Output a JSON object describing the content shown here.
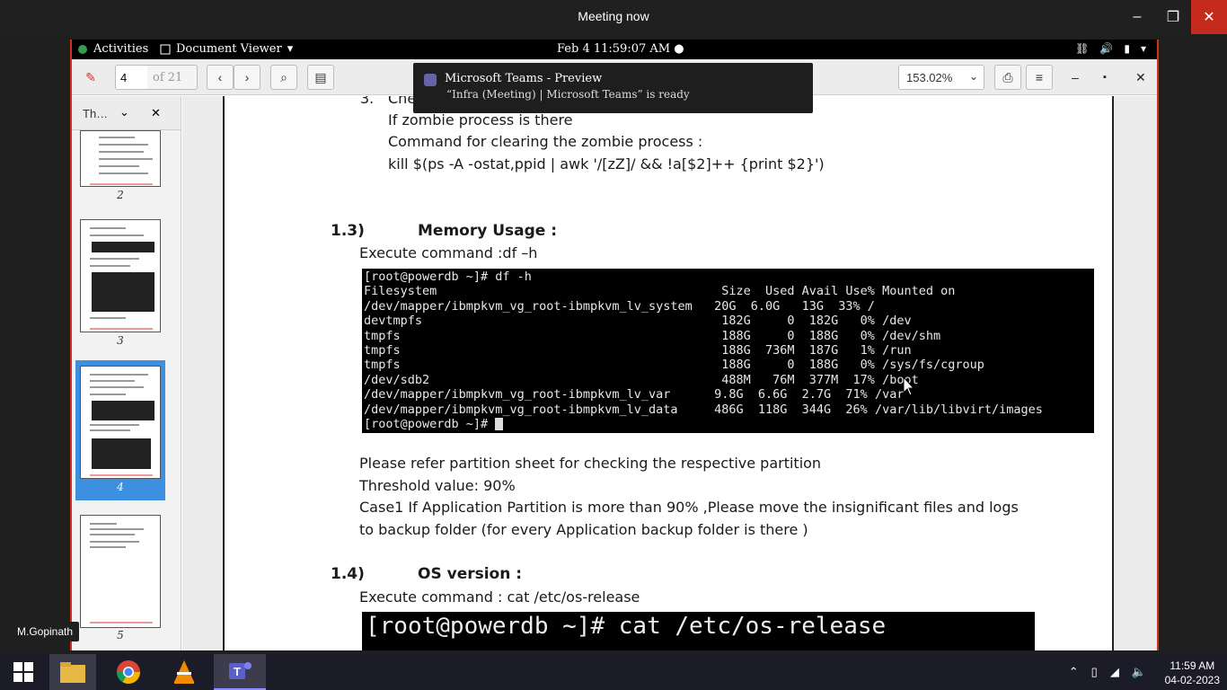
{
  "meeting_window": {
    "title": "Meeting now",
    "min": "–",
    "max": "❐",
    "close": "✕"
  },
  "gnome": {
    "activities": "Activities",
    "app_menu": "Document Viewer",
    "clock": "Feb 4  11:59:07 AM ●"
  },
  "toolbar": {
    "page_value": "4",
    "page_of": "of 21",
    "zoom": "153.02%"
  },
  "sidebar": {
    "dropdown": "Th…",
    "thumbs": [
      {
        "num": "2"
      },
      {
        "num": "3"
      },
      {
        "num": "4"
      },
      {
        "num": "5"
      }
    ]
  },
  "doc": {
    "item3_prefix": "3.",
    "item3_text": "Che",
    "line_zombie": "If zombie process is there",
    "line_cmd_label": "Command for clearing the zombie process :",
    "line_kill": "kill $(ps -A -ostat,ppid | awk '/[zZ]/ && !a[$2]++ {print $2}')",
    "sec13_num": "1.3)",
    "sec13_title": "Memory Usage :",
    "sec13_exec": "Execute command :df –h",
    "terminal_lines": [
      "[root@powerdb ~]# df -h",
      "Filesystem                                       Size  Used Avail Use% Mounted on",
      "/dev/mapper/ibmpkvm_vg_root-ibmpkvm_lv_system   20G  6.0G   13G  33% /",
      "devtmpfs                                         182G     0  182G   0% /dev",
      "tmpfs                                            188G     0  188G   0% /dev/shm",
      "tmpfs                                            188G  736M  187G   1% /run",
      "tmpfs                                            188G     0  188G   0% /sys/fs/cgroup",
      "/dev/sdb2                                        488M   76M  377M  17% /boot",
      "/dev/mapper/ibmpkvm_vg_root-ibmpkvm_lv_var      9.8G  6.6G  2.7G  71% /var",
      "/dev/mapper/ibmpkvm_vg_root-ibmpkvm_lv_data     486G  118G  344G  26% /var/lib/libvirt/images"
    ],
    "terminal_prompt": "[root@powerdb ~]# ",
    "refer": "Please refer partition sheet for checking the respective partition",
    "threshold": "Threshold value: 90%",
    "case1_a": "Case1 If Application Partition is more than 90% ,Please move the insignificant files and  logs",
    "case1_b": "to backup folder (for every Application backup folder is there )",
    "sec14_num": "1.4)",
    "sec14_title": "OS version :",
    "sec14_exec": "Execute command : cat /etc/os-release",
    "term2": "[root@powerdb ~]# cat /etc/os-release"
  },
  "toast": {
    "title": "Microsoft Teams - Preview",
    "body": "“Infra (Meeting) | Microsoft Teams” is ready"
  },
  "name_tag": "M.Gopinath",
  "taskbar": {
    "time": "11:59 AM",
    "date": "04-02-2023"
  },
  "colors": {
    "accent": "#3d8fe0",
    "frame_border": "#d32f1f",
    "teams": "#6264a7"
  }
}
